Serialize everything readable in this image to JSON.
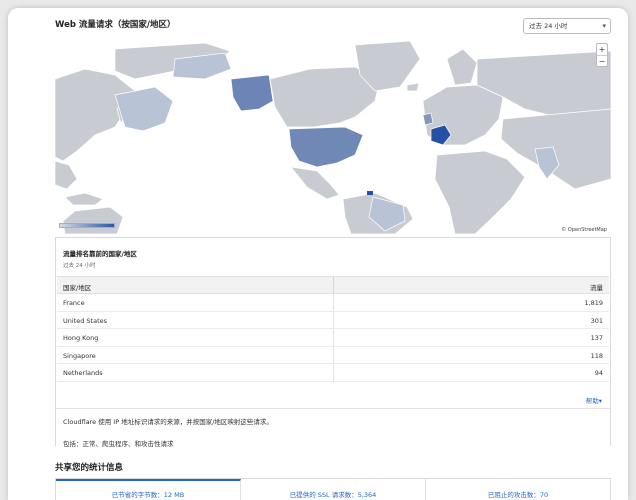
{
  "header": {
    "title": "Web 流量请求（按国家/地区）",
    "time_select": "过去 24 小时"
  },
  "map": {
    "zoom_in": "+",
    "zoom_out": "−",
    "attribution": "© OpenStreetMap",
    "colors": {
      "ocean": "#ffffff",
      "land": "#c8ccd2",
      "low": "#b9c3d6",
      "mid": "#8596b8",
      "high": "#6c84b6",
      "top": "#2451a6"
    }
  },
  "top_countries": {
    "title": "流量排名靠前的国家/地区",
    "subtitle": "过去 24 小时",
    "columns": [
      "国家/地区",
      "流量"
    ],
    "rows": [
      {
        "country": "France",
        "traffic": "1,819"
      },
      {
        "country": "United States",
        "traffic": "301"
      },
      {
        "country": "Hong Kong",
        "traffic": "137"
      },
      {
        "country": "Singapore",
        "traffic": "118"
      },
      {
        "country": "Netherlands",
        "traffic": "94"
      }
    ],
    "help_link": "帮助",
    "note_1": "Cloudflare 使用 IP 地址标识请求的来源，并按国家/地区映射这些请求。",
    "note_2": "包括：正常、爬虫程序、和攻击性请求"
  },
  "share": {
    "title": "共享您的统计信息",
    "stats": [
      {
        "label": "已节省的字节数：12 MB",
        "active": true
      },
      {
        "label": "已提供的 SSL 请求数：5,364",
        "active": false
      },
      {
        "label": "已阻止的攻击数：70",
        "active": false
      }
    ]
  }
}
